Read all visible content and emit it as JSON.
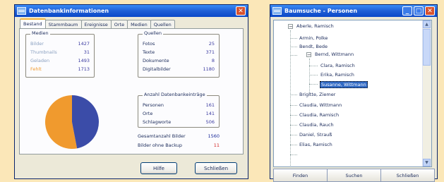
{
  "left_window": {
    "title": "Datenbankinformationen",
    "tabs": [
      "Bestand",
      "Stammbaum",
      "Ereignisse",
      "Orte",
      "Medien",
      "Quellen"
    ],
    "active_tab": 0,
    "group_media": {
      "legend": "Medien",
      "rows": [
        {
          "label": "Bilder",
          "value": "1427"
        },
        {
          "label": "Thumbnails",
          "value": "31"
        },
        {
          "label": "Geladen",
          "value": "1493"
        },
        {
          "label": "Fehlt",
          "value": "1713"
        }
      ]
    },
    "group_sources": {
      "legend": "Quellen",
      "rows": [
        {
          "label": "Fotos",
          "value": "25"
        },
        {
          "label": "Texte",
          "value": "371"
        },
        {
          "label": "Dokumente",
          "value": "8"
        },
        {
          "label": "Digitalbilder",
          "value": "1180"
        }
      ]
    },
    "group_entries": {
      "legend": "Anzahl Datenbankeinträge",
      "rows": [
        {
          "label": "Personen",
          "value": "161"
        },
        {
          "label": "Orte",
          "value": "141"
        },
        {
          "label": "Schlagworte",
          "value": "506"
        }
      ]
    },
    "totals": [
      {
        "label": "Gesamtanzahl Bilder",
        "value": "1560",
        "color": "#1a2a9a"
      },
      {
        "label": "Bilder ohne Backup",
        "value": "11",
        "color": "#d02020"
      }
    ],
    "pie": {
      "orange_share": 0.53,
      "blue_share": 0.47,
      "orange": "#F09A2E",
      "blue": "#3B4CA8"
    },
    "buttons": {
      "help": "Hilfe",
      "close": "Schließen"
    }
  },
  "right_window": {
    "title": "Baumsuche - Personen",
    "tree": {
      "root": "Aberle, Ramisch",
      "children": [
        "Armin, Polke",
        "Bendt, Bede",
        "Bernd, Wittmann"
      ],
      "grandchildren": [
        "Clara, Ramisch",
        "Erika, Ramisch",
        "Susanne, Wittmann"
      ],
      "selected": "Susanne, Wittmann",
      "siblings_after": [
        "Brigitte, Ziemer",
        "Claudia, Wittmann",
        "Claudia, Ramisch",
        "Claudia, Rauch",
        "Daniel, Strauß",
        "Elias, Ramisch"
      ]
    },
    "buttons": [
      "Finden",
      "Suchen",
      "Schließen"
    ]
  }
}
